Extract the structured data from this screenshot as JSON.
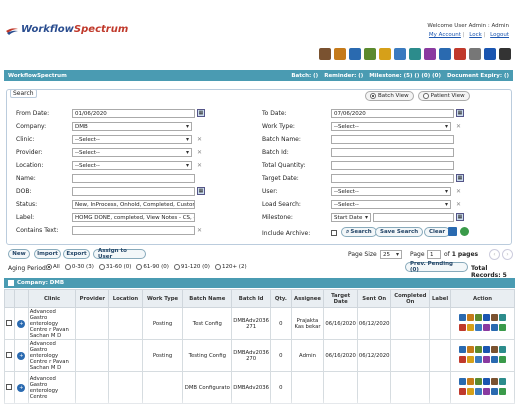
{
  "app": {
    "logo_part1": "Workflow",
    "logo_part2": "Spectrum"
  },
  "user": {
    "welcome": "Welcome User Admin : Admin",
    "my_account": "My Account",
    "lock": "Lock",
    "logout": "Logout",
    "sep": "|"
  },
  "toolbar_icons": [
    "home-icon",
    "search-icon",
    "document-icon",
    "calendar-icon",
    "folder-icon",
    "checklist-icon",
    "users-icon",
    "person-icon",
    "chart-icon",
    "gauge-icon",
    "settings-icon",
    "help-icon",
    "power-icon"
  ],
  "toolbar_colors": [
    "#7a5230",
    "#c57a1a",
    "#2a6ab0",
    "#5b8a2e",
    "#d6a019",
    "#3a7abf",
    "#2c8c8c",
    "#8a3aa0",
    "#2a6ab0",
    "#c0392b",
    "#777777",
    "#1a55b0",
    "#333333"
  ],
  "statusbar": {
    "title": "WorkflowSpectrum",
    "batch": "Batch: ()",
    "reminder": "Reminder: ()",
    "milestone": "Milestone: (5) () (0) (0)",
    "doc_expiry": "Document Expiry: ()"
  },
  "search": {
    "title": "Search",
    "batch_view": "Batch View",
    "patient_view": "Patient View",
    "from_date_label": "From Date:",
    "from_date": "01/06/2020",
    "to_date_label": "To Date:",
    "to_date": "07/06/2020",
    "company_label": "Company:",
    "company": "DMB",
    "work_type_label": "Work Type:",
    "work_type": "--Select--",
    "clinic_label": "Clinic:",
    "clinic": "--Select--",
    "batch_name_label": "Batch Name:",
    "provider_label": "Provider:",
    "provider": "--Select--",
    "batch_id_label": "Batch Id:",
    "location_label": "Location:",
    "location": "--Select--",
    "total_qty_label": "Total Quantity:",
    "name_label": "Name:",
    "target_date_label": "Target Date:",
    "dob_label": "DOB:",
    "user_label": "User:",
    "user": "--Select--",
    "status_label": "Status:",
    "status": "New, InProcess, Onhold, Completed, Custom, Pe",
    "load_search_label": "Load Search:",
    "load_search": "--Select--",
    "label_label": "Label:",
    "label": "HOMG DONE, completed, View Notes - CS, @ p",
    "milestone_label": "Milestone:",
    "milestone": "Start Date",
    "contains_text_label": "Contains Text:",
    "include_archive_label": "Include Archive:",
    "search_btn": "Search",
    "save_search_btn": "Save Search",
    "clear_btn": "Clear"
  },
  "actions": {
    "new": "New",
    "import": "Import",
    "export": "Export",
    "assign": "Assign to User",
    "page_size_label": "Page Size",
    "page_size": "25",
    "page_label": "Page",
    "page": "1",
    "of_pages": "of",
    "total_pages": "1",
    "pages_word": "pages",
    "prev_pending": "Prev. Pending (0)",
    "total_records": "Total Records: 5"
  },
  "aging": {
    "label": "Aging Period:",
    "options": [
      "All",
      "0-30 (3)",
      "31-60 (0)",
      "61-90 (0)",
      "91-120 (0)",
      "120+ (2)"
    ]
  },
  "grid": {
    "group": "Company: DMB",
    "columns": [
      "Clinic",
      "Provider",
      "Location",
      "Work Type",
      "Batch Name",
      "Batch Id",
      "Qty.",
      "Assignee",
      "Target Date",
      "Sent On",
      "Completed On",
      "Label",
      "Action"
    ],
    "rows": [
      {
        "clinic": "Advanced Gastro enterology Centre r Pavan Sachan M D",
        "provider": "",
        "location": "",
        "work_type": "Posting",
        "batch_name": "Test Config",
        "batch_id": "DMBAdv2036 271",
        "qty": "0",
        "assignee": "Prajakta Kas bekar",
        "target": "06/16/2020",
        "sent_on": "06/12/2020",
        "completed": "",
        "label": ""
      },
      {
        "clinic": "Advanced Gastro enterology Centre r Pavan Sachan M D",
        "provider": "",
        "location": "",
        "work_type": "Posting",
        "batch_name": "Testing Config",
        "batch_id": "DMBAdv2036 270",
        "qty": "0",
        "assignee": "Admin",
        "target": "06/16/2020",
        "sent_on": "06/12/2020",
        "completed": "",
        "label": ""
      },
      {
        "clinic": "Advanced Gastro enterology Centre",
        "provider": "",
        "location": "",
        "work_type": "",
        "batch_name": "DMB Configurato",
        "batch_id": "DMBAdv2036",
        "qty": "0",
        "assignee": "",
        "target": "",
        "sent_on": "",
        "completed": "",
        "label": ""
      }
    ]
  }
}
